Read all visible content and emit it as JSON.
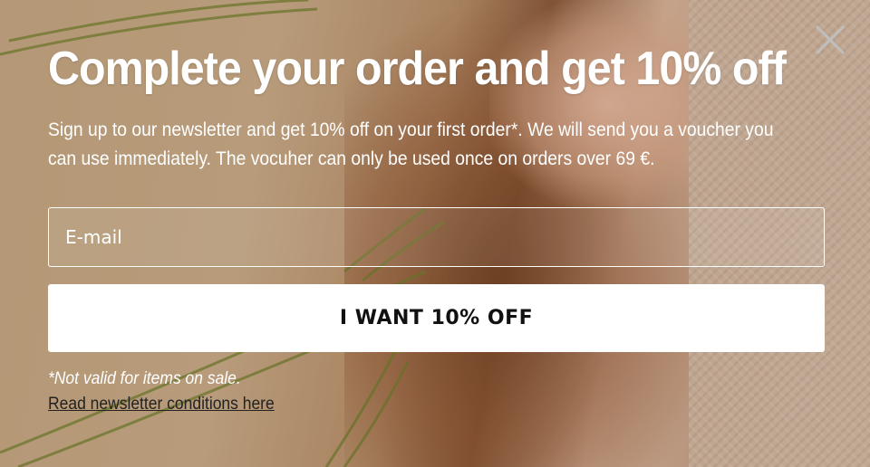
{
  "popup": {
    "title": "Complete your order and get 10% off",
    "description": "Sign up to our newsletter and get 10% off on your first order*. We will send you a voucher you can use immediately. The vocuher can only be used once on orders over 69 €.",
    "email_placeholder": "E-mail",
    "cta_label": "I WANT 10% OFF",
    "note": "*Not valid for items on sale.",
    "conditions_link": "Read newsletter conditions here",
    "close_icon": "close-icon"
  }
}
